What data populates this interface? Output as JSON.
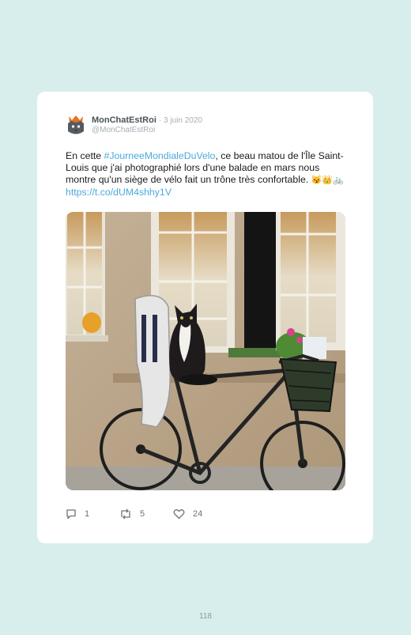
{
  "tweet": {
    "author_name": "MonChatEstRoi",
    "date": "· 3 juin 2020",
    "handle": "@MonChatEstRoi",
    "text_before": "En cette ",
    "hashtag": "#JourneeMondialeDuVelo",
    "text_after": ", ce beau matou de l'Île Saint-Louis que j'ai photographié lors d'une balade en mars nous montre qu'un siège de vélo fait un trône très confortable. ",
    "emojis": "😼👑🚲",
    "link": "https://t.co/dUM4shhy1V",
    "image_icon": "cat-on-bicycle-photo",
    "replies": "1",
    "retweets": "5",
    "likes": "24"
  },
  "page_number": "118",
  "colors": {
    "background": "#d8eeec",
    "card": "#ffffff",
    "link": "#4aa9dd"
  }
}
